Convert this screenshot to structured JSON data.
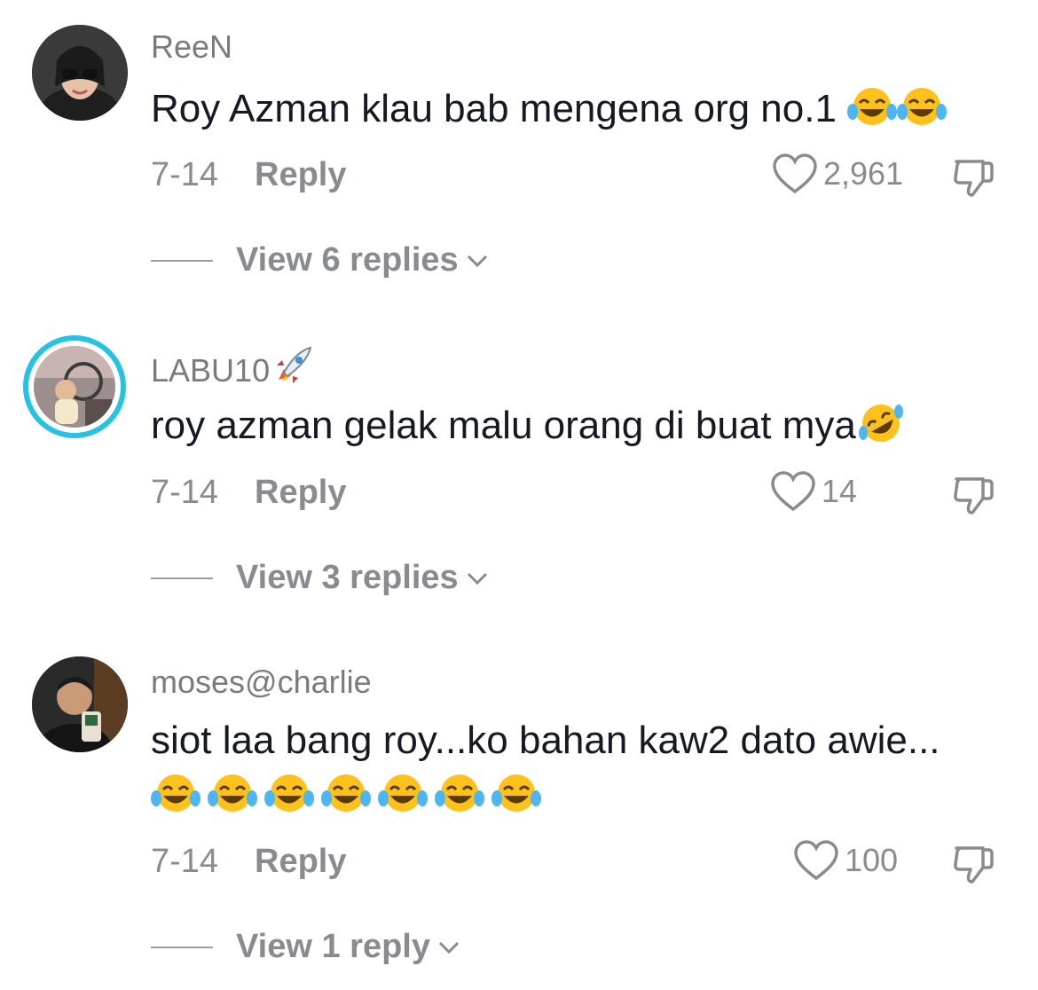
{
  "comments": [
    {
      "username": "ReeN",
      "text": "Roy Azman klau bab mengena org no.1",
      "emojis": [
        "joy-emoji",
        "joy-emoji"
      ],
      "date": "7-14",
      "reply_label": "Reply",
      "likes": "2,961",
      "view_replies": "View 6 replies"
    },
    {
      "username": "LABU10",
      "username_emoji": "rocket-emoji",
      "text": "roy azman gelak malu orang di buat mya",
      "emojis": [
        "rofl-emoji"
      ],
      "date": "7-14",
      "reply_label": "Reply",
      "likes": "14",
      "view_replies": "View 3 replies"
    },
    {
      "username": "moses@charlie",
      "text": "siot laa bang roy...ko bahan kaw2 dato awie...",
      "emojis": [
        "joy-emoji",
        "joy-emoji",
        "joy-emoji",
        "joy-emoji",
        "joy-emoji",
        "joy-emoji",
        "joy-emoji"
      ],
      "date": "7-14",
      "reply_label": "Reply",
      "likes": "100",
      "view_replies": "View 1 reply"
    }
  ],
  "colors": {
    "text": "#161823",
    "muted": "#8a8b91",
    "ring": "#25c2e4"
  }
}
